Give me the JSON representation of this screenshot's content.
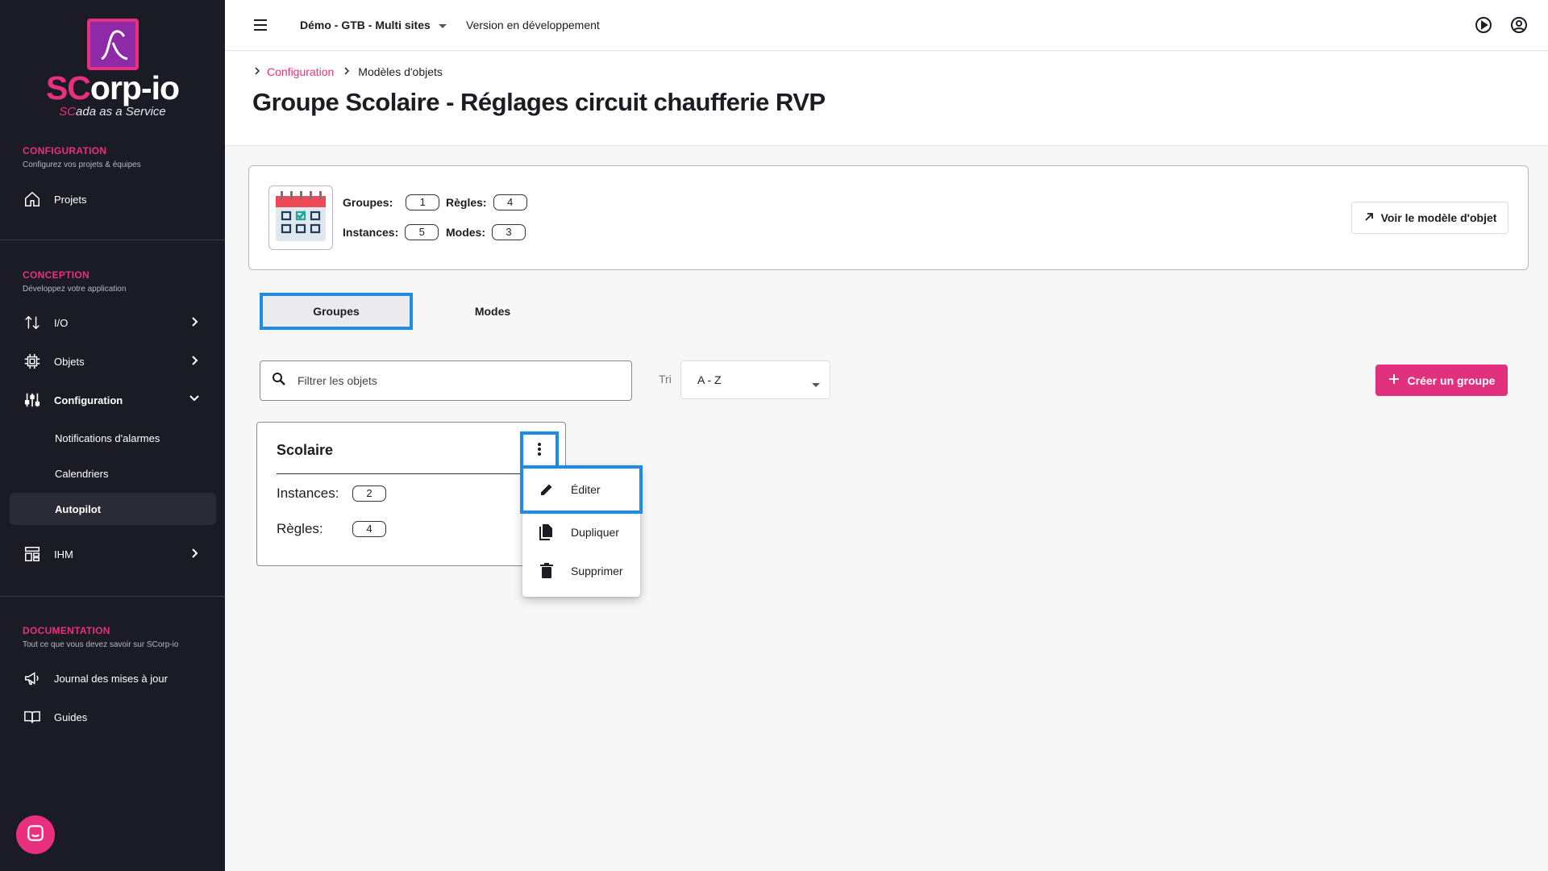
{
  "brand": {
    "logo_prefix": "SC",
    "logo_suffix": "orp-io",
    "tagline_prefix": "SC",
    "tagline_suffix": "ada as a Service",
    "accent_color": "#e8307f"
  },
  "sidebar": {
    "sections": [
      {
        "title": "CONFIGURATION",
        "subtitle": "Configurez vos projets & équipes"
      },
      {
        "title": "CONCEPTION",
        "subtitle": "Développez votre application"
      },
      {
        "title": "DOCUMENTATION",
        "subtitle": "Tout ce que vous devez savoir sur SCorp-io"
      }
    ],
    "items": {
      "projets": {
        "label": "Projets",
        "icon": "home-icon"
      },
      "io": {
        "label": "I/O",
        "icon": "swap-vertical-icon"
      },
      "objets": {
        "label": "Objets",
        "icon": "chip-icon"
      },
      "configuration": {
        "label": "Configuration",
        "icon": "sliders-icon"
      },
      "notifications": {
        "label": "Notifications d'alarmes"
      },
      "calendriers": {
        "label": "Calendriers"
      },
      "autopilot": {
        "label": "Autopilot"
      },
      "ihm": {
        "label": "IHM",
        "icon": "dashboard-icon"
      },
      "journal": {
        "label": "Journal des mises à jour",
        "icon": "megaphone-icon"
      },
      "guides": {
        "label": "Guides",
        "icon": "book-icon"
      }
    }
  },
  "topbar": {
    "project": "Démo - GTB - Multi sites",
    "version": "Version en développement"
  },
  "breadcrumb": {
    "parent": "Configuration",
    "current": "Modèles d'objets"
  },
  "page": {
    "title": "Groupe Scolaire - Réglages circuit chaufferie RVP"
  },
  "summary": {
    "groupes_label": "Groupes:",
    "groupes_value": "1",
    "regles_label": "Règles:",
    "regles_value": "4",
    "instances_label": "Instances:",
    "instances_value": "5",
    "modes_label": "Modes:",
    "modes_value": "3",
    "view_button": "Voir le modèle d'objet"
  },
  "tabs": {
    "groupes": "Groupes",
    "modes": "Modes"
  },
  "filters": {
    "search_placeholder": "Filtrer les objets",
    "sort_label": "Tri",
    "sort_value": "A - Z",
    "create_button": "Créer un groupe"
  },
  "group_card": {
    "name": "Scolaire",
    "instances_label": "Instances:",
    "instances_value": "2",
    "regles_label": "Règles:",
    "regles_value": "4"
  },
  "context_menu": {
    "edit": "Éditer",
    "duplicate": "Dupliquer",
    "delete": "Supprimer"
  }
}
